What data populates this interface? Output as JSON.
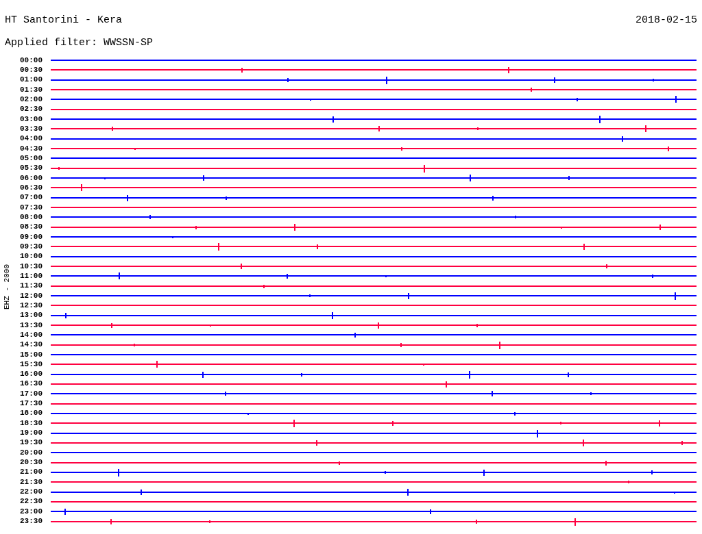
{
  "header": {
    "station": "HT Santorini - Kera",
    "date": "2018-02-15",
    "filter": "Applied filter: WWSSN-SP"
  },
  "channel_label": "EHZ - 2000",
  "traces": [
    {
      "time": "00:00",
      "color": "#0000ff"
    },
    {
      "time": "00:30",
      "color": "#ff0040"
    },
    {
      "time": "01:00",
      "color": "#0000ff"
    },
    {
      "time": "01:30",
      "color": "#ff0040"
    },
    {
      "time": "02:00",
      "color": "#0000ff"
    },
    {
      "time": "02:30",
      "color": "#ff0040"
    },
    {
      "time": "03:00",
      "color": "#0000ff"
    },
    {
      "time": "03:30",
      "color": "#ff0040"
    },
    {
      "time": "04:00",
      "color": "#0000ff"
    },
    {
      "time": "04:30",
      "color": "#ff0040"
    },
    {
      "time": "05:00",
      "color": "#0000ff"
    },
    {
      "time": "05:30",
      "color": "#ff0040"
    },
    {
      "time": "06:00",
      "color": "#0000ff"
    },
    {
      "time": "06:30",
      "color": "#ff0040"
    },
    {
      "time": "07:00",
      "color": "#0000ff"
    },
    {
      "time": "07:30",
      "color": "#ff0040"
    },
    {
      "time": "08:00",
      "color": "#0000ff"
    },
    {
      "time": "08:30",
      "color": "#ff0040"
    },
    {
      "time": "09:00",
      "color": "#0000ff"
    },
    {
      "time": "09:30",
      "color": "#ff0040"
    },
    {
      "time": "10:00",
      "color": "#0000ff"
    },
    {
      "time": "10:30",
      "color": "#ff0040"
    },
    {
      "time": "11:00",
      "color": "#0000ff"
    },
    {
      "time": "11:30",
      "color": "#ff0040"
    },
    {
      "time": "12:00",
      "color": "#0000ff"
    },
    {
      "time": "12:30",
      "color": "#ff0040"
    },
    {
      "time": "13:00",
      "color": "#0000ff"
    },
    {
      "time": "13:30",
      "color": "#ff0040"
    },
    {
      "time": "14:00",
      "color": "#0000ff"
    },
    {
      "time": "14:30",
      "color": "#ff0040"
    },
    {
      "time": "15:00",
      "color": "#0000ff"
    },
    {
      "time": "15:30",
      "color": "#ff0040"
    },
    {
      "time": "16:00",
      "color": "#0000ff"
    },
    {
      "time": "16:30",
      "color": "#ff0040"
    },
    {
      "time": "17:00",
      "color": "#0000ff"
    },
    {
      "time": "17:30",
      "color": "#ff0040"
    },
    {
      "time": "18:00",
      "color": "#0000ff"
    },
    {
      "time": "18:30",
      "color": "#ff0040"
    },
    {
      "time": "19:00",
      "color": "#0000ff"
    },
    {
      "time": "19:30",
      "color": "#ff0040"
    },
    {
      "time": "20:00",
      "color": "#0000ff"
    },
    {
      "time": "20:30",
      "color": "#ff0040"
    },
    {
      "time": "21:00",
      "color": "#0000ff"
    },
    {
      "time": "21:30",
      "color": "#ff0040"
    },
    {
      "time": "22:00",
      "color": "#0000ff"
    },
    {
      "time": "22:30",
      "color": "#ff0040"
    },
    {
      "time": "23:00",
      "color": "#0000ff"
    },
    {
      "time": "23:30",
      "color": "#ff0040"
    }
  ]
}
